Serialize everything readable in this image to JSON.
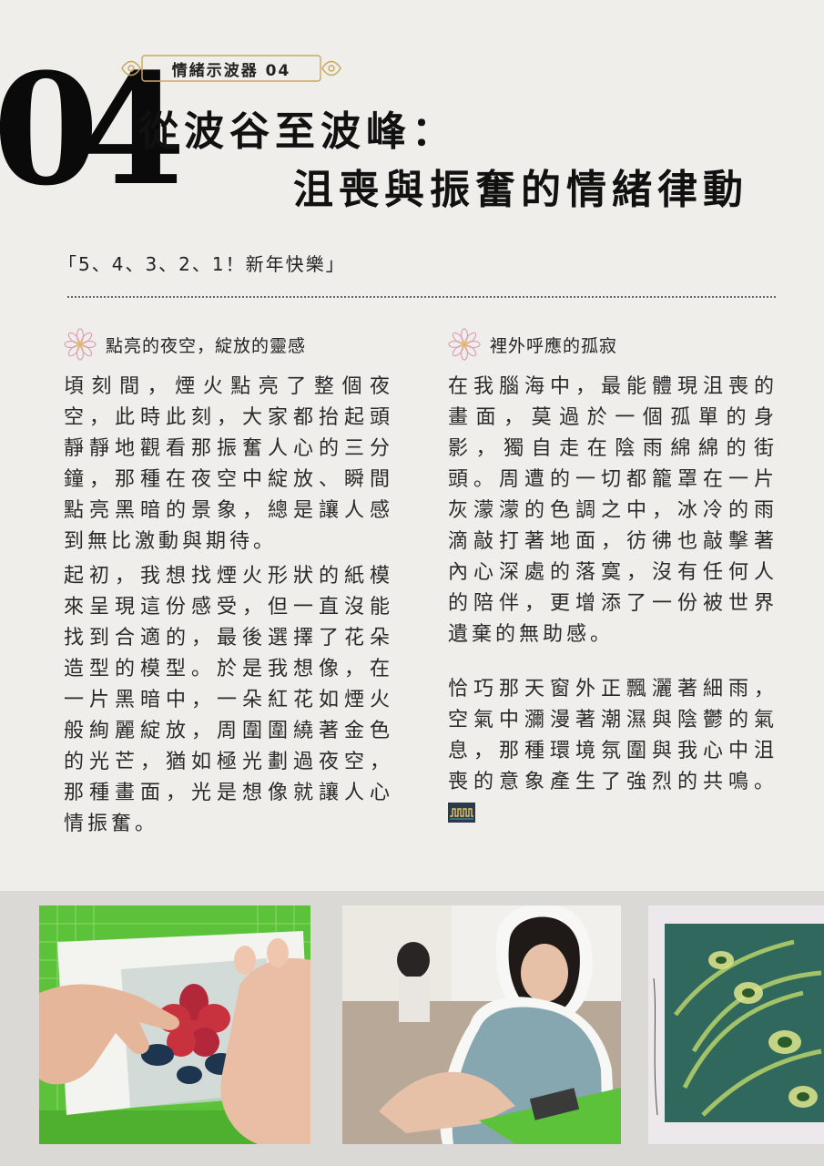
{
  "header": {
    "number": "04",
    "series_tag": "情緒示波器 04",
    "title_line1": "從波谷至波峰：",
    "title_line2": "沮喪與振奮的情緒律動"
  },
  "quote": "「5、4、3、2、1！新年快樂」",
  "left_column": {
    "heading": "點亮的夜空，綻放的靈感",
    "paragraphs": [
      "頃刻間，煙火點亮了整個夜空，此時此刻，大家都抬起頭靜靜地觀看那振奮人心的三分鐘，那種在夜空中綻放、瞬間點亮黑暗的景象，總是讓人感到無比激動與期待。",
      "起初，我想找煙火形狀的紙模來呈現這份感受，但一直沒能找到合適的，最後選擇了花朵造型的模型。於是我想像，在一片黑暗中，一朵紅花如煙火般絢麗綻放，周圍圍繞著金色的光芒，猶如極光劃過夜空，那種畫面，光是想像就讓人心情振奮。"
    ]
  },
  "right_column": {
    "heading": "裡外呼應的孤寂",
    "paragraphs": [
      "在我腦海中，最能體現沮喪的畫面，莫過於一個孤單的身影，獨自走在陰雨綿綿的街頭。周遭的一切都籠罩在一片灰濛濛的色調之中，冰冷的雨滴敲打著地面，彷彿也敲擊著內心深處的落寞，沒有任何人的陪伴，更增添了一份被世界遺棄的無助感。",
      "恰巧那天窗外正飄灑著細雨，空氣中瀰漫著潮濕與陰鬱的氣息，那種環境氛圍與我心中沮喪的意象產生了強烈的共鳴。"
    ]
  },
  "icons": {
    "heading_ornament": "flower-ornament-icon",
    "end_mark": "oscilloscope-wave-icon"
  },
  "colors": {
    "background": "#efeeea",
    "gallery_band": "#dad9d5",
    "tag_gold": "#c9a961",
    "cutting_mat_green": "#5cc23a",
    "flower_red": "#c8323e",
    "stencil_teal": "#2f6e78"
  }
}
